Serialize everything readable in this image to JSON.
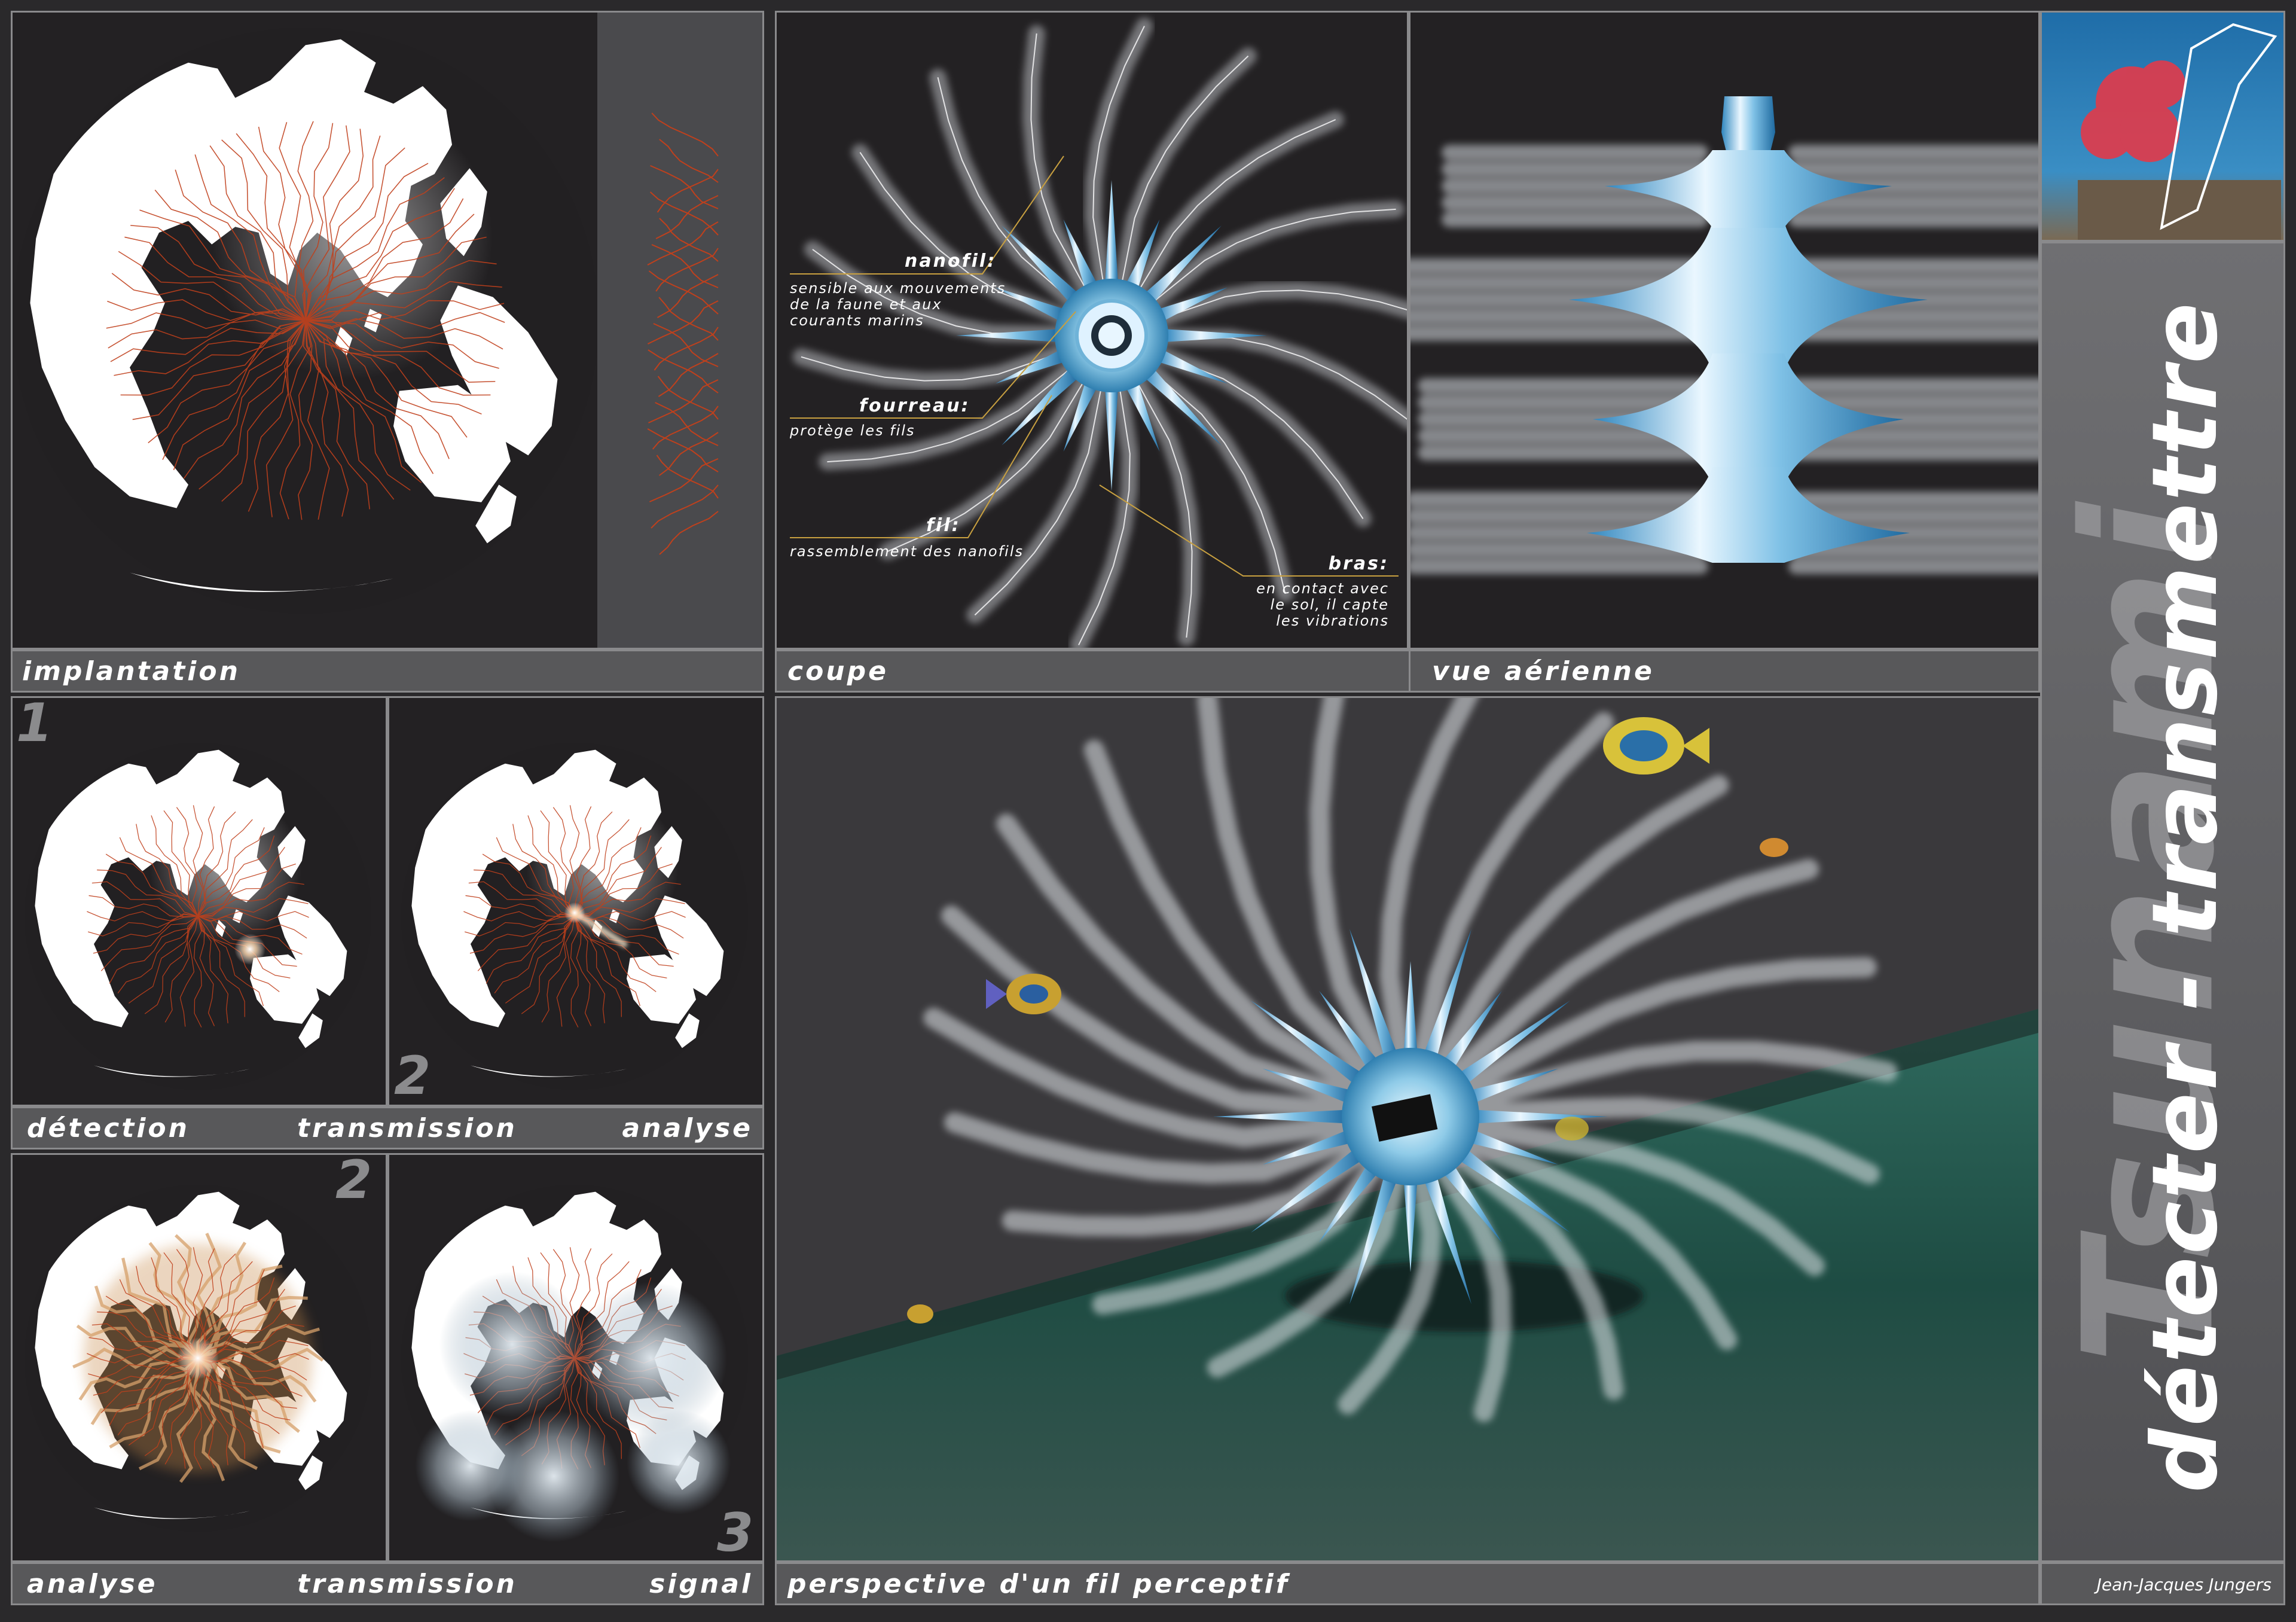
{
  "captions": {
    "implantation": "implantation",
    "coupe": "coupe",
    "vue_aerienne": "vue aérienne",
    "row2": [
      "détection",
      "transmission",
      "analyse"
    ],
    "row3": [
      "analyse",
      "transmission",
      "signal"
    ],
    "perspective": "perspective d'un fil perceptif",
    "author": "Jean-Jacques Jungers"
  },
  "step_numbers": [
    "1",
    "2",
    "2",
    "3"
  ],
  "annotations": {
    "nanofil": {
      "title": "nanofil:",
      "desc": [
        "sensible aux mouvements",
        "de la faune et aux",
        "courants marins"
      ]
    },
    "fourreau": {
      "title": "fourreau:",
      "desc": [
        "protège les fils"
      ]
    },
    "fil": {
      "title": "fil:",
      "desc": [
        "rassemblement des nanofils"
      ]
    },
    "bras": {
      "title": "bras:",
      "desc": [
        "en contact avec",
        "le sol, il capte",
        "les vibrations"
      ]
    }
  },
  "sidebar": {
    "title": "détecter - transmettre",
    "ghost": "Tsunami"
  },
  "colors": {
    "background": "#2a292b",
    "panel": "#232123",
    "caption_bar": "#58585a",
    "border": "#8a8a8c",
    "accent_orange": "#c8a040",
    "filament_red": "#c0401c",
    "glow_blue": "#9fd6ee"
  },
  "icons": [
    "globe-icon",
    "sea-urchin-sensor",
    "fish-icon",
    "coral-photo"
  ]
}
